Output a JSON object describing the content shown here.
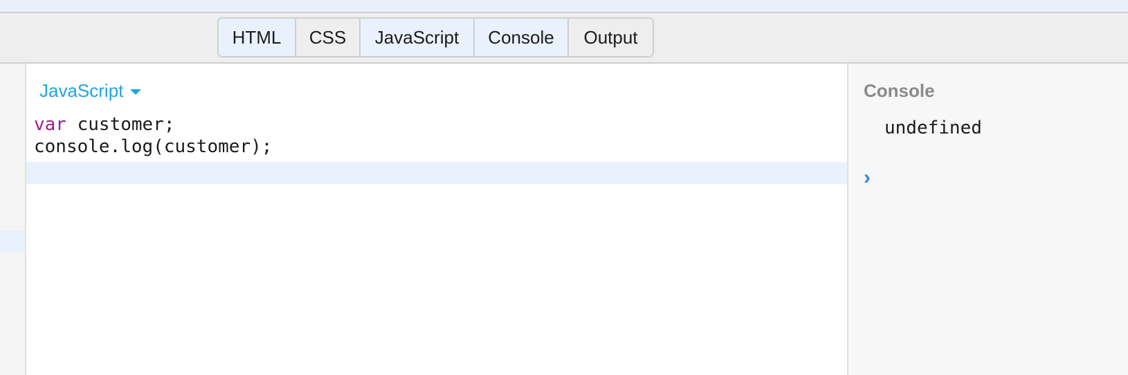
{
  "tabs": [
    {
      "label": "HTML",
      "active": true
    },
    {
      "label": "CSS",
      "active": false
    },
    {
      "label": "JavaScript",
      "active": true
    },
    {
      "label": "Console",
      "active": true
    },
    {
      "label": "Output",
      "active": false
    }
  ],
  "editor": {
    "language": "JavaScript",
    "code": {
      "line1_keyword": "var",
      "line1_rest": " customer;",
      "line2": "console.log(customer);"
    }
  },
  "console": {
    "title": "Console",
    "output": "undefined",
    "prompt_glyph": "›"
  },
  "colors": {
    "accent_blue": "#1ea5e0",
    "keyword_purple": "#9b1f8c",
    "prompt_blue": "#2e86e6",
    "active_tab_bg": "#e9f1fc"
  },
  "icons": {
    "dropdown": "caret-down-icon",
    "prompt": "chevron-right-icon"
  }
}
